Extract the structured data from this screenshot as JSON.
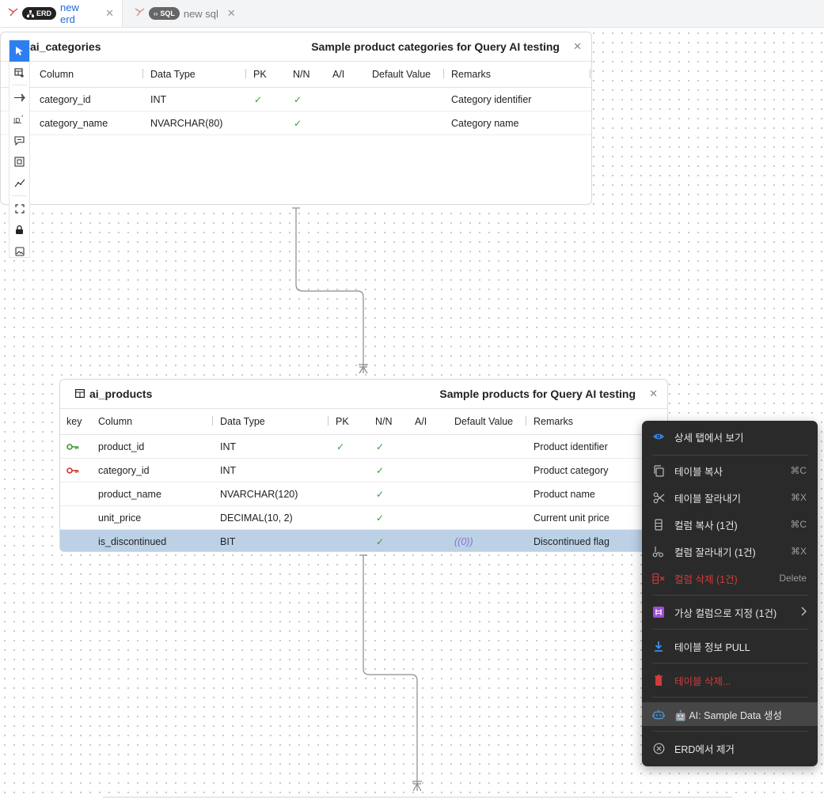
{
  "tabs": [
    {
      "badge": "ERD",
      "name": "new erd",
      "active": true
    },
    {
      "badge": "SQL",
      "name": "new sql",
      "active": false
    }
  ],
  "toolbar": {
    "icons": [
      "pointer-icon",
      "add-table-icon",
      "relation-icon",
      "id-icon",
      "comment-icon",
      "frame-icon",
      "auto-layout-icon",
      "fit-screen-icon",
      "lock-icon",
      "image-export-icon"
    ]
  },
  "table_categories": {
    "name": "ai_categories",
    "description": "Sample product categories for Query AI testing",
    "columns_header": [
      "Column",
      "Data Type",
      "PK",
      "N/N",
      "A/I",
      "Default Value",
      "Remarks"
    ],
    "rows": [
      {
        "column": "category_id",
        "type": "INT",
        "pk": "✓",
        "nn": "✓",
        "ai": "",
        "default": "",
        "remarks": "Category identifier"
      },
      {
        "column": "category_name",
        "type": "NVARCHAR(80)",
        "pk": "",
        "nn": "✓",
        "ai": "",
        "default": "",
        "remarks": "Category name"
      }
    ]
  },
  "table_products": {
    "name": "ai_products",
    "description": "Sample products for Query AI testing",
    "columns_header": [
      "key",
      "Column",
      "Data Type",
      "PK",
      "N/N",
      "A/I",
      "Default Value",
      "Remarks"
    ],
    "rows": [
      {
        "key": "pk",
        "column": "product_id",
        "type": "INT",
        "pk": "✓",
        "nn": "✓",
        "ai": "",
        "default": "",
        "remarks": "Product identifier"
      },
      {
        "key": "fk",
        "column": "category_id",
        "type": "INT",
        "pk": "",
        "nn": "✓",
        "ai": "",
        "default": "",
        "remarks": "Product category"
      },
      {
        "key": "",
        "column": "product_name",
        "type": "NVARCHAR(120)",
        "pk": "",
        "nn": "✓",
        "ai": "",
        "default": "",
        "remarks": "Product name"
      },
      {
        "key": "",
        "column": "unit_price",
        "type": "DECIMAL(10, 2)",
        "pk": "",
        "nn": "✓",
        "ai": "",
        "default": "",
        "remarks": "Current unit price"
      },
      {
        "key": "",
        "column": "is_discontinued",
        "type": "BIT",
        "pk": "",
        "nn": "✓",
        "ai": "",
        "default": "((0))",
        "remarks": "Discontinued flag",
        "selected": true
      }
    ]
  },
  "context_menu": {
    "items": [
      {
        "label": "상세 탭에서 보기",
        "shortcut": "",
        "icon": "eye-icon"
      },
      {
        "label": "테이블 복사",
        "shortcut": "⌘C",
        "icon": "copy-icon"
      },
      {
        "label": "테이블 잘라내기",
        "shortcut": "⌘X",
        "icon": "scissors-icon"
      },
      {
        "label": "컬럼 복사 (1건)",
        "shortcut": "⌘C",
        "icon": "column-copy-icon"
      },
      {
        "label": "컬럼 잘라내기 (1건)",
        "shortcut": "⌘X",
        "icon": "column-cut-icon"
      },
      {
        "label": "컬럼 삭제 (1건)",
        "shortcut": "Delete",
        "icon": "column-delete-icon"
      },
      {
        "label": "가상 컬럼으로 지정 (1건)",
        "shortcut": "",
        "icon": "virtual-column-icon"
      },
      {
        "label": "테이블 정보 PULL",
        "shortcut": "",
        "icon": "download-icon"
      },
      {
        "label": "테이블 삭제...",
        "shortcut": "",
        "icon": "trash-icon"
      },
      {
        "label": "🤖 AI: Sample Data 생성",
        "shortcut": "",
        "icon": "robot-icon"
      },
      {
        "label": "ERD에서 제거",
        "shortcut": "",
        "icon": "remove-circle-icon"
      }
    ]
  },
  "colors": {
    "accent": "#1e6bd6",
    "pk_key": "#3a9a34",
    "fk_key": "#c9342a",
    "danger": "#d33b3b",
    "selection": "#bcd1e6"
  }
}
